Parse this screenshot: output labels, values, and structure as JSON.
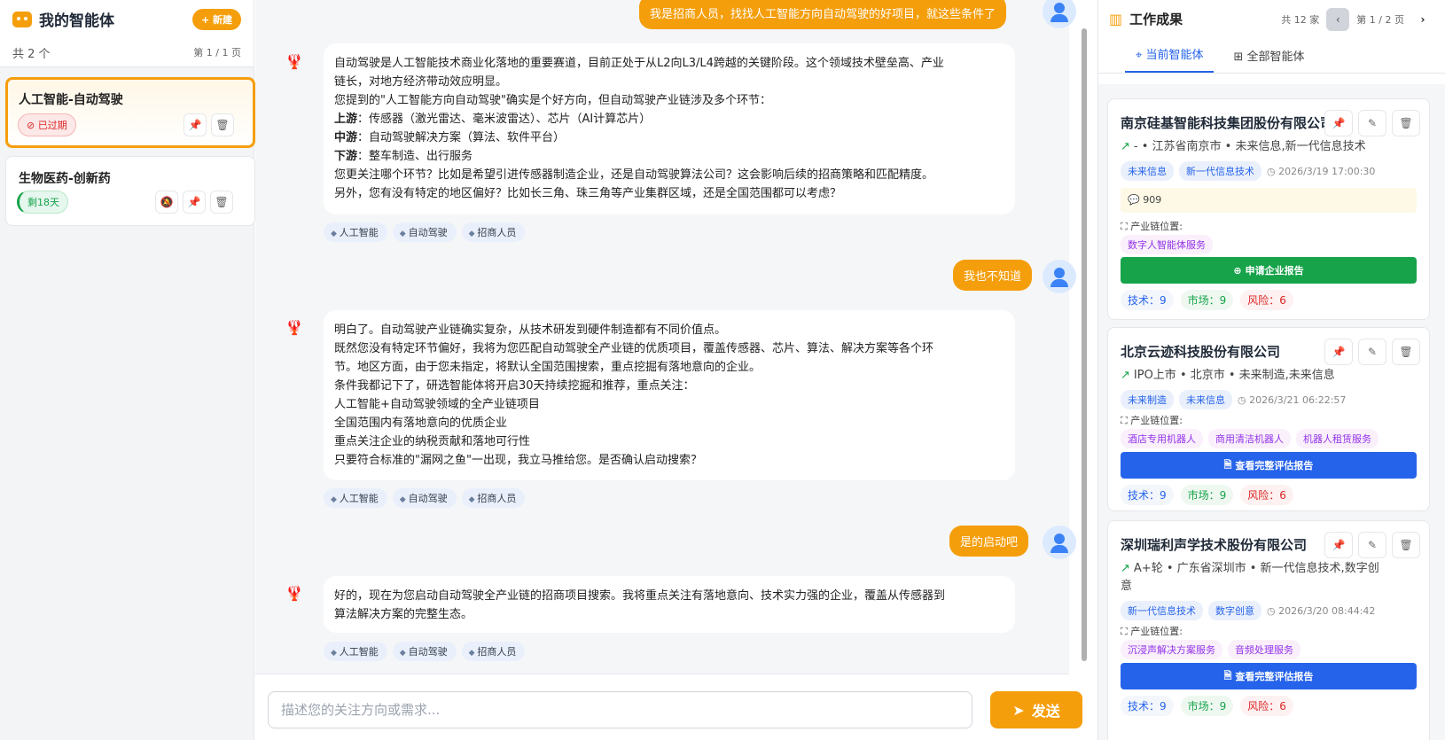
{
  "sidebar": {
    "title": "我的智能体",
    "new_label": "+ 新建",
    "total": "共 2 个",
    "page": "第 1 / 1 页",
    "agents": [
      {
        "name": "人工智能-自动驾驶",
        "badge": "已过期"
      },
      {
        "name": "生物医药-创新药",
        "badge": "剩18天"
      }
    ]
  },
  "chat": {
    "messages": [
      {
        "role": "user",
        "text": "我是招商人员，找找人工智能方向自动驾驶的好项目，就这些条件了"
      },
      {
        "role": "bot",
        "lines": [
          "自动驾驶是人工智能技术商业化落地的重要赛道，目前正处于从L2向L3/L4跨越的关键阶段。这个领域技术壁垒高、产业",
          "链长，对地方经济带动效应明显。",
          "您提到的\"人工智能方向自动驾驶\"确实是个好方向，但自动驾驶产业链涉及多个环节：",
          "",
          "",
          "",
          "您更关注哪个环节？比如是希望引进传感器制造企业，还是自动驾驶算法公司？这会影响后续的招商策略和匹配精度。",
          "另外，您有没有特定的地区偏好？比如长三角、珠三角等产业集群区域，还是全国范围都可以考虑？"
        ],
        "chain": [
          {
            "k": "上游",
            "v": "：传感器（激光雷达、毫米波雷达）、芯片（AI计算芯片）"
          },
          {
            "k": "中游",
            "v": "：自动驾驶解决方案（算法、软件平台）"
          },
          {
            "k": "下游",
            "v": "：整车制造、出行服务"
          }
        ],
        "tags": [
          "人工智能",
          "自动驾驶",
          "招商人员"
        ]
      },
      {
        "role": "user",
        "text": "我也不知道"
      },
      {
        "role": "bot",
        "lines": [
          "明白了。自动驾驶产业链确实复杂，从技术研发到硬件制造都有不同价值点。",
          "既然您没有特定环节偏好，我将为您匹配自动驾驶全产业链的优质项目，覆盖传感器、芯片、算法、解决方案等各个环",
          "节。地区方面，由于您未指定，将默认全国范围搜索，重点挖掘有落地意向的企业。",
          "条件我都记下了，研选智能体将开启30天持续挖掘和推荐，重点关注：",
          "人工智能+自动驾驶领域的全产业链项目",
          "全国范围内有落地意向的优质企业",
          "重点关注企业的纳税贡献和落地可行性",
          "只要符合标准的\"漏网之鱼\"一出现，我立马推给您。是否确认启动搜索？"
        ],
        "tags": [
          "人工智能",
          "自动驾驶",
          "招商人员"
        ]
      },
      {
        "role": "user",
        "text": "是的启动吧"
      },
      {
        "role": "bot",
        "lines": [
          "好的，现在为您启动自动驾驶全产业链的招商项目搜索。我将重点关注有落地意向、技术实力强的企业，覆盖从传感器到",
          "算法解决方案的完整生态。"
        ],
        "tags": [
          "人工智能",
          "自动驾驶",
          "招商人员"
        ]
      }
    ],
    "input_placeholder": "描述您的关注方向或需求...",
    "send_label": "发送"
  },
  "results": {
    "title": "工作成果",
    "count": "共 12 家",
    "page": "第 1 / 2 页",
    "tabs": [
      "当前智能体",
      "全部智能体"
    ],
    "chain_label": "产业链位置:",
    "cards": [
      {
        "name": "南京硅基智能科技集团股份有限公司",
        "info": "- • 江苏省南京市 • 未来信息,新一代信息技术",
        "tags": [
          "未来信息",
          "新一代信息技术"
        ],
        "time": "2026/3/19 17:00:30",
        "msg": "909",
        "chain": [
          "数字人智能体服务"
        ],
        "button": "申请企业报告",
        "scores": {
          "tech": "技术：9",
          "market": "市场：9",
          "risk": "风险：6"
        }
      },
      {
        "name": "北京云迹科技股份有限公司",
        "info": "IPO上市 • 北京市 • 未来制造,未来信息",
        "tags": [
          "未来制造",
          "未来信息"
        ],
        "time": "2026/3/21 06:22:57",
        "chain": [
          "酒店专用机器人",
          "商用清洁机器人",
          "机器人租赁服务"
        ],
        "button": "查看完整评估报告",
        "scores": {
          "tech": "技术：9",
          "market": "市场：9",
          "risk": "风险：6"
        }
      },
      {
        "name": "深圳瑞利声学技术股份有限公司",
        "info_line1": "A+轮 • 广东省深圳市 • 新一代信息技术,数字创",
        "info_line2": "意",
        "tags": [
          "新一代信息技术",
          "数字创意"
        ],
        "time": "2026/3/20 08:44:42",
        "chain": [
          "沉浸声解决方案服务",
          "音频处理服务"
        ],
        "button": "查看完整评估报告",
        "scores": {
          "tech": "技术：9",
          "market": "市场：9",
          "risk": "风险：6"
        }
      }
    ]
  },
  "colors": {
    "accent": "#f59e0b",
    "primary": "#2563eb",
    "success": "#16a34a",
    "danger": "#dc2626"
  }
}
